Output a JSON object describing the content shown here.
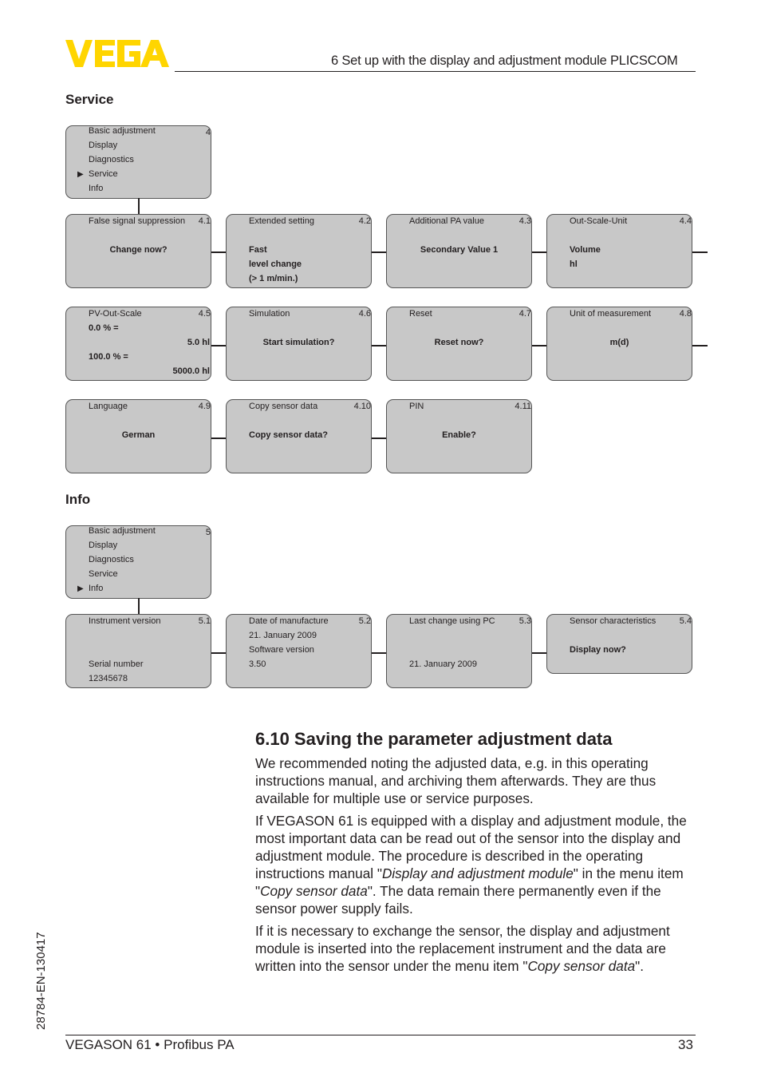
{
  "header": {
    "logo_text": "VEGA",
    "logo_color": "#ffd500",
    "chapter_title": "6 Set up with the display and adjustment module PLICSCOM"
  },
  "service": {
    "heading": "Service",
    "main_menu": {
      "items": [
        "Basic adjustment",
        "Display",
        "Diagnostics",
        "Service",
        "Info"
      ],
      "selected_index": 3,
      "number": "4"
    },
    "boxes": [
      {
        "title": "False signal suppression",
        "number": "4.1",
        "lines": [
          "Change now?"
        ]
      },
      {
        "title": "Extended setting",
        "number": "4.2",
        "lines": [
          "Fast",
          "level change",
          "(> 1 m/min.)"
        ]
      },
      {
        "title": "Additional PA value",
        "number": "4.3",
        "lines": [
          "Secondary Value 1"
        ]
      },
      {
        "title": "Out-Scale-Unit",
        "number": "4.4",
        "lines": [
          "Volume",
          "hl"
        ]
      },
      {
        "title": "PV-Out-Scale",
        "number": "4.5",
        "lines": [
          "0.0 % =",
          "5.0 hl",
          "100.0 % =",
          "5000.0 hl"
        ]
      },
      {
        "title": "Simulation",
        "number": "4.6",
        "lines": [
          "Start simulation?"
        ]
      },
      {
        "title": "Reset",
        "number": "4.7",
        "lines": [
          "Reset now?"
        ]
      },
      {
        "title": "Unit of measurement",
        "number": "4.8",
        "lines": [
          "m(d)"
        ]
      },
      {
        "title": "Language",
        "number": "4.9",
        "lines": [
          "German"
        ]
      },
      {
        "title": "Copy sensor data",
        "number": "4.10",
        "lines": [
          "Copy sensor data?"
        ]
      },
      {
        "title": "PIN",
        "number": "4.11",
        "lines": [
          "Enable?"
        ]
      }
    ]
  },
  "info": {
    "heading": "Info",
    "main_menu": {
      "items": [
        "Basic adjustment",
        "Display",
        "Diagnostics",
        "Service",
        "Info"
      ],
      "selected_index": 4,
      "number": "5"
    },
    "boxes": [
      {
        "title": "Instrument version",
        "number": "5.1",
        "lines": [
          "Serial number",
          "12345678"
        ]
      },
      {
        "title": "Date of manufacture",
        "number": "5.2",
        "lines": [
          "21. January 2009",
          "Software version",
          "3.50"
        ]
      },
      {
        "title": "Last change using PC",
        "number": "5.3",
        "lines": [
          "21. January 2009"
        ]
      },
      {
        "title": "Sensor characteristics",
        "number": "5.4",
        "lines": [
          "Display now?"
        ]
      }
    ]
  },
  "section": {
    "title": "6.10  Saving the parameter adjustment data",
    "p1": "We recommended noting the adjusted data, e.g. in this operating instructions manual, and archiving them afterwards. They are thus available for multiple use or service purposes.",
    "p2_a": "If VEGASON 61 is equipped with a display and adjustment module, the most important data can be read out of the sensor into the display and adjustment module. The procedure is described in the operating instructions manual \"",
    "p2_i1": "Display and adjustment module",
    "p2_b": "\" in the menu item \"",
    "p2_i2": "Copy sensor data",
    "p2_c": "\". The data remain there permanently even if the sensor power supply fails.",
    "p3_a": "If it is necessary to exchange the sensor, the display and adjustment module is inserted into the replacement instrument and the data are written into the sensor under the menu item \"",
    "p3_i": "Copy sensor data",
    "p3_b": "\"."
  },
  "footer": {
    "doc_code": "28784-EN-130417",
    "product": "VEGASON 61 • Profibus PA",
    "page_number": "33"
  }
}
